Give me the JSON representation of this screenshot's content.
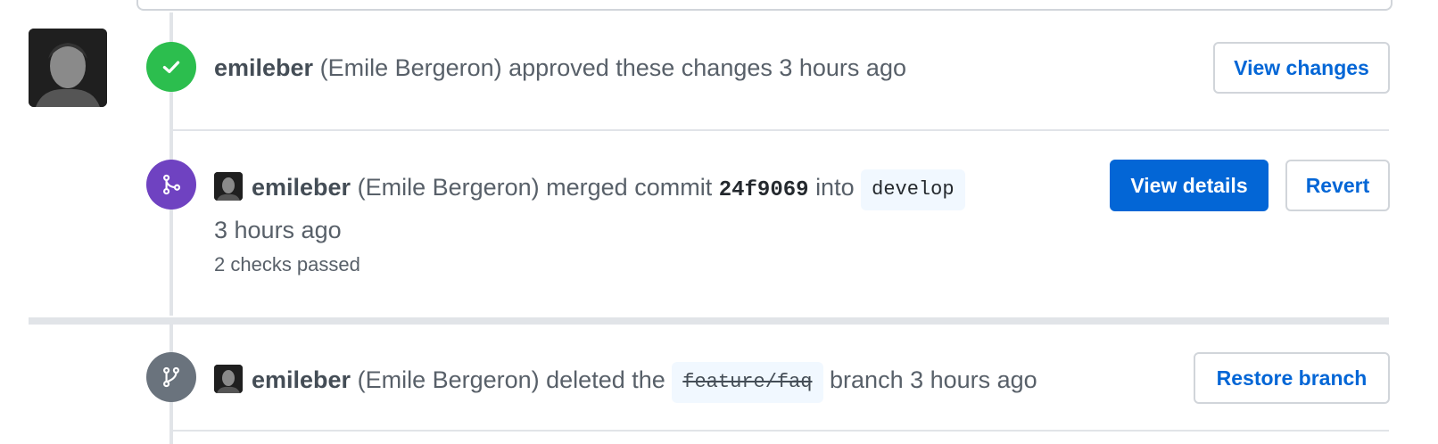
{
  "colors": {
    "approved_badge": "#2cbe4e",
    "merged_badge": "#6f42c1",
    "deleted_badge": "#6a737d",
    "link_blue": "#0366d6",
    "primary_button": "#0366d6"
  },
  "events": {
    "approved": {
      "icon": "check-icon",
      "author": "emileber",
      "rest": "(Emile Bergeron) approved these changes 3 hours ago",
      "button": "View changes"
    },
    "merged": {
      "icon": "git-merge-icon",
      "author": "emileber",
      "text_before_sha": "(Emile Bergeron) merged commit",
      "sha": "24f9069",
      "text_into": "into",
      "branch": "develop",
      "time": "3 hours ago",
      "checks": "2 checks passed",
      "primary_button": "View details",
      "secondary_button": "Revert"
    },
    "deleted": {
      "icon": "git-branch-icon",
      "author": "emileber",
      "text_before_branch": "(Emile Bergeron) deleted the",
      "branch": "feature/faq",
      "text_after_branch": "branch 3 hours ago",
      "button": "Restore branch"
    }
  }
}
